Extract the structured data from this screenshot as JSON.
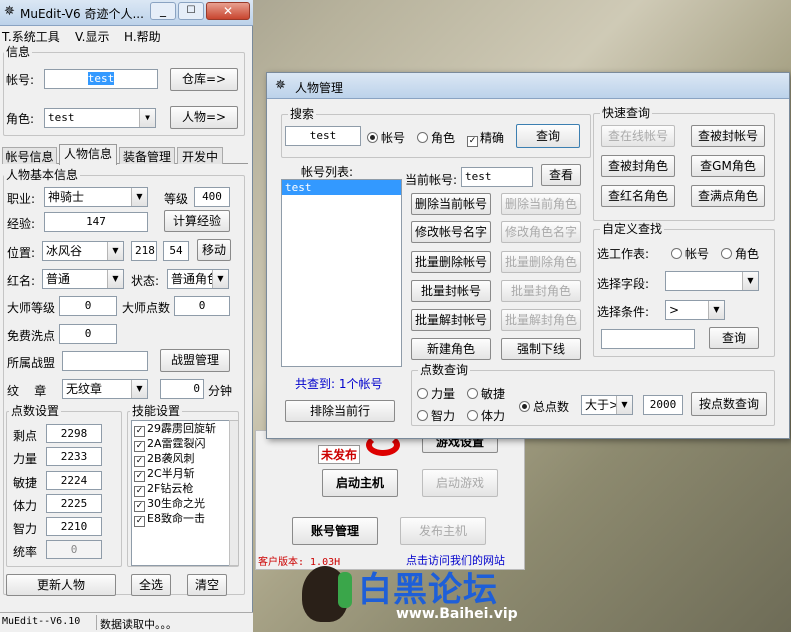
{
  "left_window": {
    "title": "MuEdit-V6  奇迹个人...",
    "menu": [
      "T.系统工具",
      "V.显示",
      "H.帮助"
    ],
    "info_group": "信息",
    "account_label": "帐号:",
    "account_value": "test",
    "warehouse_button": "仓库=>",
    "role_label": "角色:",
    "role_value": "test",
    "character_button": "人物=>",
    "tabs": [
      "帐号信息",
      "人物信息",
      "装备管理",
      "开发中"
    ],
    "basic_group": "人物基本信息",
    "job_label": "职业:",
    "job_value": "神骑士",
    "level_label": "等级",
    "level_value": "400",
    "exp_label": "经验:",
    "exp_value": "147",
    "calc_exp_button": "计算经验",
    "pos_label": "位置:",
    "pos_map": "冰风谷",
    "pos_x": "218",
    "pos_y": "54",
    "move_button": "移动",
    "redname_label": "红名:",
    "redname_value": "普通",
    "state_label": "状态:",
    "state_value": "普通角色",
    "master_level_label": "大师等级",
    "master_level_value": "0",
    "master_points_label": "大师点数",
    "master_points_value": "0",
    "free_wash_label": "免费洗点",
    "free_wash_value": "0",
    "guild_label": "所属战盟",
    "guild_value": "",
    "guild_button": "战盟管理",
    "emblem_label": "纹    章",
    "emblem_value": "无纹章",
    "emblem_num": "0",
    "emblem_unit": "分钟",
    "points_group": "点数设置",
    "points": [
      {
        "label": "剩点",
        "value": "2298"
      },
      {
        "label": "力量",
        "value": "2233"
      },
      {
        "label": "敏捷",
        "value": "2224"
      },
      {
        "label": "体力",
        "value": "2225"
      },
      {
        "label": "智力",
        "value": "2210"
      },
      {
        "label": "统率",
        "value": "0"
      }
    ],
    "skills_group": "技能设置",
    "skills": [
      "29霹雳回旋斩",
      "2A雷霆裂闪",
      "2B袭风刺",
      "2C半月斩",
      "2F钻云枪",
      "30生命之光",
      "E8致命一击"
    ],
    "update_button": "更新人物",
    "select_all_button": "全选",
    "clear_button": "清空",
    "status_left": "MuEdit--V6.10",
    "status_right": "数据读取中。。。"
  },
  "dialog": {
    "title": "人物管理",
    "search_group": "搜索",
    "search_value": "test",
    "radio_account": "帐号",
    "radio_role": "角色",
    "exact_label": "精确",
    "query_button": "查询",
    "list_label": "帐号列表:",
    "list_items": [
      "test"
    ],
    "current_account_label": "当前帐号:",
    "current_account_value": "test",
    "view_button": "查看",
    "del_account": "删除当前帐号",
    "del_role": "删除当前角色",
    "rename_account": "修改帐号名字",
    "rename_role": "修改角色名字",
    "batch_del_account": "批量删除帐号",
    "batch_del_role": "批量删除角色",
    "batch_ban_account": "批量封帐号",
    "batch_ban_role": "批量封角色",
    "batch_unban_account": "批量解封帐号",
    "batch_unban_role": "批量解封角色",
    "new_role": "新建角色",
    "force_logout": "强制下线",
    "found_text": "共查到: 1个帐号",
    "exclude_button": "排除当前行",
    "quick_group": "快速查询",
    "quick_buttons": [
      "查在线帐号",
      "查被封帐号",
      "查被封角色",
      "查GM角色",
      "查红名角色",
      "查满点角色"
    ],
    "custom_group": "自定义查找",
    "table_label": "选工作表:",
    "t_account": "帐号",
    "t_role": "角色",
    "field_label": "选择字段:",
    "cond_label": "选择条件:",
    "cond_value": ">",
    "custom_query_button": "查询",
    "points_query_group": "点数查询",
    "pq_strength": "力量",
    "pq_agility": "敏捷",
    "pq_intel": "智力",
    "pq_stamina": "体力",
    "pq_total": "总点数",
    "pq_op": "大于>",
    "pq_value": "2000",
    "pq_button": "按点数查询"
  },
  "background_window": {
    "unpublished": "未发布",
    "game_settings": "游戏设置",
    "start_host": "启动主机",
    "start_game": "启动游戏",
    "account_mgmt": "账号管理",
    "publish_host": "发布主机",
    "version": "客户版本: 1.03H",
    "visit_site": "点击访问我们的网站"
  },
  "watermark": {
    "brand": "白黑论坛",
    "url": "www.Baihei.vip"
  },
  "colors": {
    "accent": "#3399ff",
    "link": "#0000cc",
    "red": "#cc0000"
  }
}
